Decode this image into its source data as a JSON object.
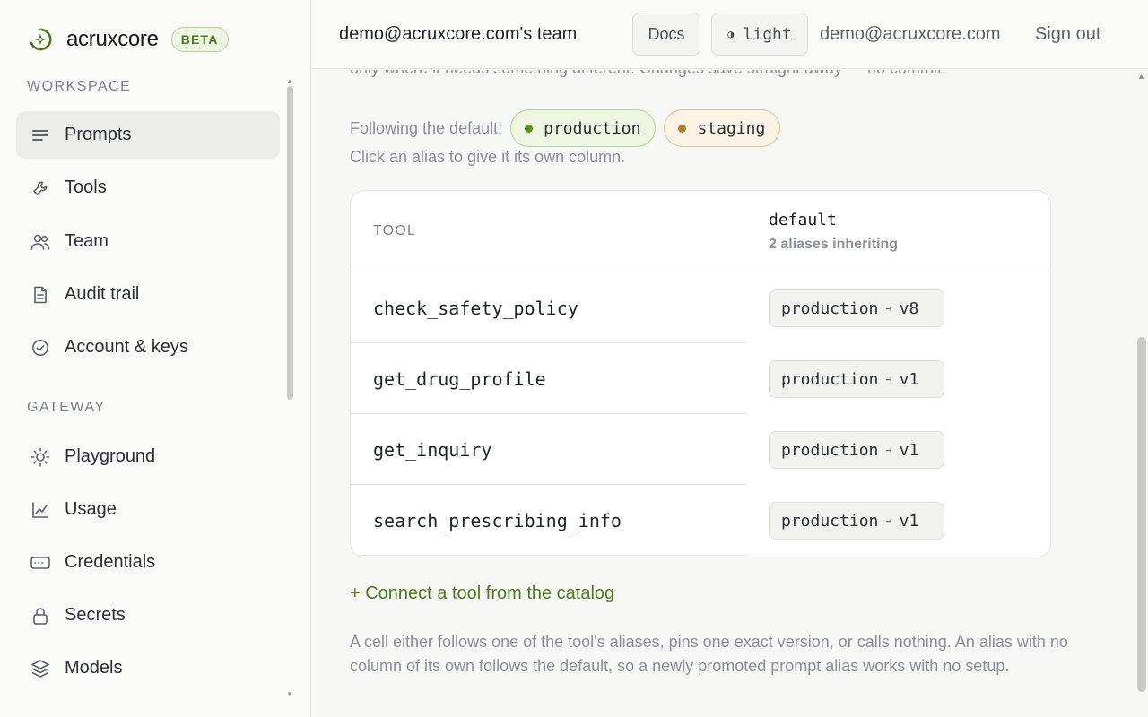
{
  "brand": {
    "name": "acruxcore",
    "badge": "BETA",
    "logo_icon": "crosshair-star-icon"
  },
  "sidebar": {
    "sections": [
      {
        "title": "WORKSPACE",
        "items": [
          {
            "label": "Prompts",
            "icon": "lines-icon",
            "active": true
          },
          {
            "label": "Tools",
            "icon": "wrench-icon"
          },
          {
            "label": "Team",
            "icon": "people-icon"
          },
          {
            "label": "Audit trail",
            "icon": "document-icon"
          },
          {
            "label": "Account & keys",
            "icon": "check-circle-icon"
          }
        ]
      },
      {
        "title": "GATEWAY",
        "items": [
          {
            "label": "Playground",
            "icon": "sun-icon"
          },
          {
            "label": "Usage",
            "icon": "chart-line-icon"
          },
          {
            "label": "Credentials",
            "icon": "card-icon"
          },
          {
            "label": "Secrets",
            "icon": "lock-icon"
          },
          {
            "label": "Models",
            "icon": "layers-icon"
          }
        ]
      }
    ]
  },
  "header": {
    "team": "demo@acruxcore.com's team",
    "docs": "Docs",
    "theme_icon": "◑",
    "theme": "light",
    "email": "demo@acruxcore.com",
    "sign_out": "Sign out"
  },
  "main": {
    "cut_text": "only where it needs something different. Changes save straight away — no commit.",
    "following_label": "Following the default:",
    "aliases": [
      {
        "name": "production",
        "color": "#5a8f1e"
      },
      {
        "name": "staging",
        "color": "#b07f2a"
      }
    ],
    "hint": "Click an alias to give it its own column.",
    "table": {
      "col_tool": "TOOL",
      "col_default": "default",
      "col_default_sub": "2 aliases inheriting",
      "rows": [
        {
          "tool": "check_safety_policy",
          "alias": "production",
          "arrow": "→",
          "version": "v8"
        },
        {
          "tool": "get_drug_profile",
          "alias": "production",
          "arrow": "→",
          "version": "v1"
        },
        {
          "tool": "get_inquiry",
          "alias": "production",
          "arrow": "→",
          "version": "v1"
        },
        {
          "tool": "search_prescribing_info",
          "alias": "production",
          "arrow": "→",
          "version": "v1"
        }
      ]
    },
    "connect_link": "+ Connect a tool from the catalog",
    "footnote": "A cell either follows one of the tool's aliases, pins one exact version, or calls nothing. An alias with no column of its own follows the default, so a newly promoted prompt alias works with no setup."
  },
  "colors": {
    "accent": "#4d7a1c",
    "accent_bg": "#eef5e3"
  }
}
